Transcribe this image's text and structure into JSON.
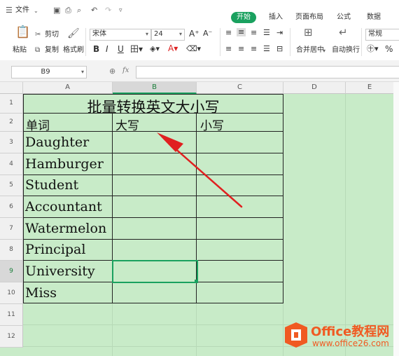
{
  "menubar": {
    "file_label": "文件",
    "tabs": [
      "开始",
      "插入",
      "页面布局",
      "公式",
      "数据"
    ]
  },
  "ribbon": {
    "paste_label": "粘贴",
    "cut_label": "剪切",
    "copy_label": "复制",
    "format_painter_label": "格式刷",
    "font_name": "宋体",
    "font_size": "24",
    "bold": "B",
    "italic": "I",
    "underline": "U",
    "merge_label": "合并居中",
    "wrap_label": "自动换行",
    "number_format": "常规",
    "percent": "%"
  },
  "formula_bar": {
    "name_box": "B9",
    "fx": "fx"
  },
  "sheet": {
    "columns": [
      "A",
      "B",
      "C",
      "D",
      "E"
    ],
    "rows": [
      "1",
      "2",
      "3",
      "4",
      "5",
      "6",
      "7",
      "8",
      "9",
      "10",
      "11",
      "12"
    ],
    "title": "批量转换英文大小写",
    "header_word": "单词",
    "header_upper": "大写",
    "header_lower": "小写",
    "words": [
      "Daughter",
      "Hamburger",
      "Student",
      "Accountant",
      "Watermelon",
      "Principal",
      "University",
      "Miss"
    ]
  },
  "watermark": {
    "brand": "Office教程网",
    "url": "www.office26.com"
  },
  "colors": {
    "sheet_fill": "#c8ebc8",
    "accent": "#1aa15f",
    "arrow": "#e02020",
    "logo": "#f05a22"
  }
}
